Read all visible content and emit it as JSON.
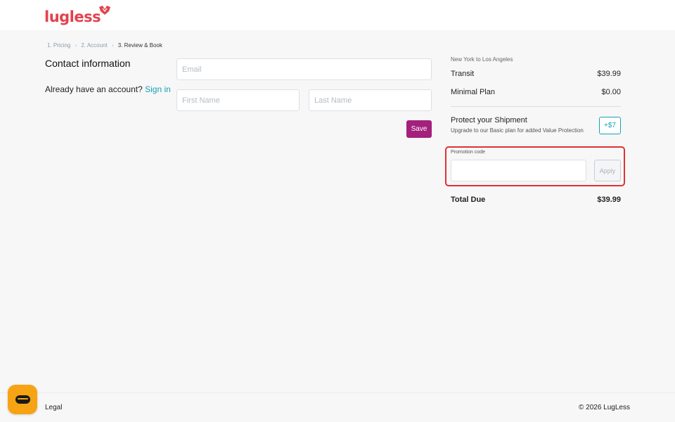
{
  "brand": {
    "name": "lugless",
    "color": "#e2434e"
  },
  "breadcrumb": [
    {
      "label": "1. Pricing"
    },
    {
      "label": "2. Account"
    },
    {
      "label": "3. Review & Book"
    }
  ],
  "contact": {
    "title": "Contact information",
    "account_prompt": "Already have an account?",
    "sign_in": "Sign in",
    "email_placeholder": "Email",
    "first_name_placeholder": "First Name",
    "last_name_placeholder": "Last Name",
    "save_label": "Save"
  },
  "summary": {
    "route": "New York to Los Angeles",
    "transit_label": "Transit",
    "transit_price": "$39.99",
    "plan_label": "Minimal Plan",
    "plan_price": "$0.00",
    "protect_title": "Protect your Shipment",
    "protect_subtitle": "Upgrade to our Basic plan for added Value Protection",
    "protect_price": "+$7",
    "promo_label": "Promotion code",
    "apply_label": "Apply",
    "total_label": "Total Due",
    "total_price": "$39.99"
  },
  "footer": {
    "legal": "Legal",
    "copyright": "© 2026 LugLess"
  },
  "colors": {
    "accent": "#17a2b8",
    "save_button": "#a3207c",
    "highlight_border": "#e03137",
    "chat_button": "#f6a314"
  },
  "icons": {
    "logo_mark": "winged-logo-icon",
    "breadcrumb_separator": "chevron-right-icon",
    "chat": "chat-bubble-icon"
  }
}
